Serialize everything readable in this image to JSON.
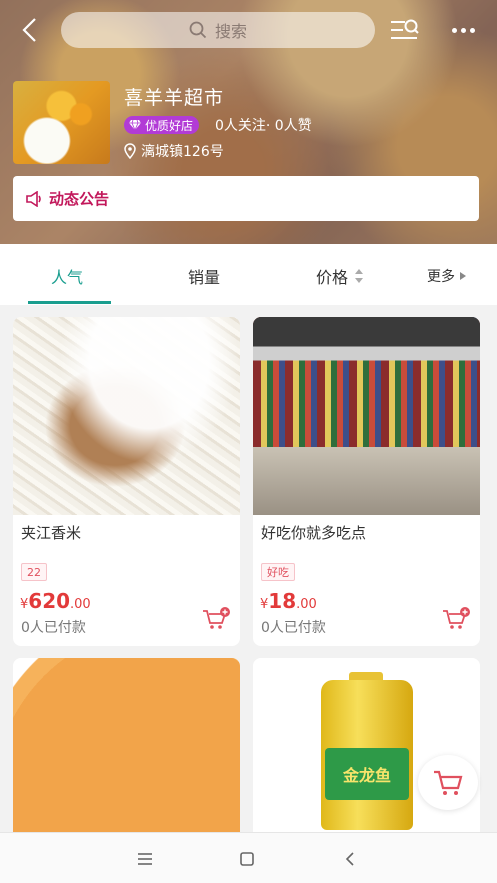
{
  "search": {
    "placeholder": "搜索"
  },
  "store": {
    "name": "喜羊羊超市",
    "badge": "优质好店",
    "stats": "0人关注· 0人赞",
    "address": "漓城镇126号"
  },
  "notice": {
    "label": "动态公告"
  },
  "tabs": [
    {
      "label": "人气",
      "active": true
    },
    {
      "label": "销量"
    },
    {
      "label": "价格"
    },
    {
      "label": "更多"
    }
  ],
  "products": [
    {
      "title": "夹江香米",
      "tag": "22",
      "price_symbol": "¥",
      "price_int": "620",
      "price_dec": ".00",
      "sold": "0人已付款"
    },
    {
      "title": "好吃你就多吃点",
      "tag": "好吃",
      "price_symbol": "¥",
      "price_int": "18",
      "price_dec": ".00",
      "sold": "0人已付款"
    },
    {
      "title": ""
    },
    {
      "title": "",
      "brand_text": "金龙鱼"
    }
  ],
  "colors": {
    "accent": "#1a9e8f",
    "price": "#e23a3a",
    "badge": "#b23bd6",
    "notice": "#c2185b"
  }
}
